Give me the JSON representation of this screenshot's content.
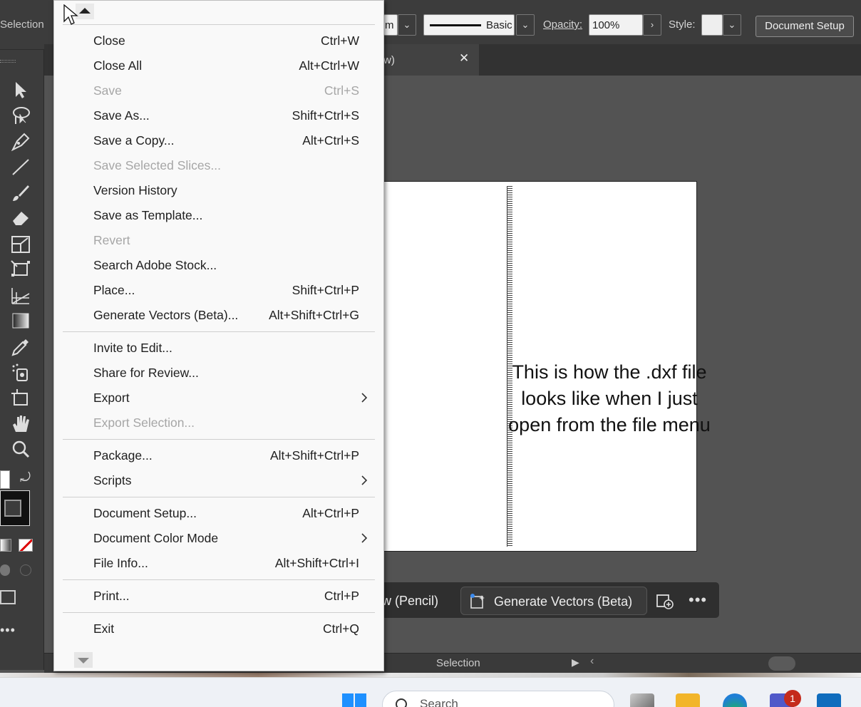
{
  "control_bar": {
    "selection_label": "Selection",
    "stroke_unit_partial": "m",
    "brush_label": "Basic",
    "opacity_label": "Opacity:",
    "opacity_value": "100%",
    "style_label": "Style:",
    "document_setup_label": "Document Setup"
  },
  "tab": {
    "label_partial": "w)",
    "close_glyph": "✕"
  },
  "canvas": {
    "annotation": "This is how the .dxf file looks like when I just open from the file menu"
  },
  "contextual_taskbar": {
    "pencil_label_partial": "w (Pencil)",
    "generate_vectors_label": "Generate Vectors (Beta)",
    "more_glyph": "•••"
  },
  "status_bar": {
    "tool_label": "Selection"
  },
  "file_menu": {
    "items": [
      {
        "label": "Close",
        "shortcut": "Ctrl+W",
        "enabled": true
      },
      {
        "label": "Close All",
        "shortcut": "Alt+Ctrl+W",
        "enabled": true
      },
      {
        "label": "Save",
        "shortcut": "Ctrl+S",
        "enabled": false
      },
      {
        "label": "Save As...",
        "shortcut": "Shift+Ctrl+S",
        "enabled": true
      },
      {
        "label": "Save a Copy...",
        "shortcut": "Alt+Ctrl+S",
        "enabled": true
      },
      {
        "label": "Save Selected Slices...",
        "shortcut": "",
        "enabled": false
      },
      {
        "label": "Version History",
        "shortcut": "",
        "enabled": true
      },
      {
        "label": "Save as Template...",
        "shortcut": "",
        "enabled": true
      },
      {
        "label": "Revert",
        "shortcut": "",
        "enabled": false
      },
      {
        "label": "Search Adobe Stock...",
        "shortcut": "",
        "enabled": true
      },
      {
        "label": "Place...",
        "shortcut": "Shift+Ctrl+P",
        "enabled": true
      },
      {
        "label": "Generate Vectors (Beta)...",
        "shortcut": "Alt+Shift+Ctrl+G",
        "enabled": true
      },
      {
        "label": "Invite to Edit...",
        "shortcut": "",
        "enabled": true
      },
      {
        "label": "Share for Review...",
        "shortcut": "",
        "enabled": true
      },
      {
        "label": "Export",
        "shortcut": "",
        "enabled": true,
        "submenu": true
      },
      {
        "label": "Export Selection...",
        "shortcut": "",
        "enabled": false
      },
      {
        "label": "Package...",
        "shortcut": "Alt+Shift+Ctrl+P",
        "enabled": true
      },
      {
        "label": "Scripts",
        "shortcut": "",
        "enabled": true,
        "submenu": true
      },
      {
        "label": "Document Setup...",
        "shortcut": "Alt+Ctrl+P",
        "enabled": true
      },
      {
        "label": "Document Color Mode",
        "shortcut": "",
        "enabled": true,
        "submenu": true
      },
      {
        "label": "File Info...",
        "shortcut": "Alt+Shift+Ctrl+I",
        "enabled": true
      },
      {
        "label": "Print...",
        "shortcut": "Ctrl+P",
        "enabled": true
      },
      {
        "label": "Exit",
        "shortcut": "Ctrl+Q",
        "enabled": true
      }
    ]
  },
  "windows_taskbar": {
    "search_placeholder": "Search",
    "teams_badge": "1"
  }
}
